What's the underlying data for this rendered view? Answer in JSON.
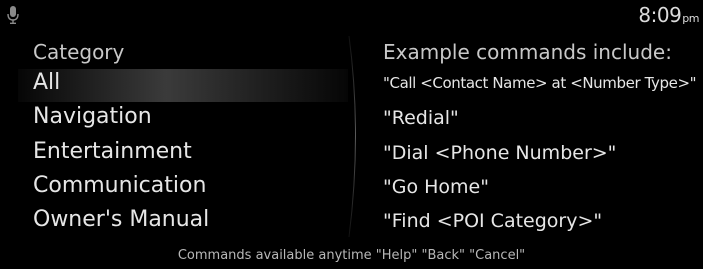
{
  "status_bar": {
    "mic_icon": "microphone-icon",
    "time": "8:09",
    "ampm": "pm"
  },
  "categories": {
    "heading": "Category",
    "selected_index": 0,
    "items": [
      {
        "label": "All"
      },
      {
        "label": "Navigation"
      },
      {
        "label": "Entertainment"
      },
      {
        "label": "Communication"
      },
      {
        "label": "Owner's Manual"
      }
    ]
  },
  "examples": {
    "heading": "Example commands include:",
    "commands": [
      {
        "text": "\"Call <Contact Name> at <Number Type>\""
      },
      {
        "text": "\"Redial\""
      },
      {
        "text": "\"Dial <Phone Number>\""
      },
      {
        "text": "\"Go Home\""
      },
      {
        "text": "\"Find <POI Category>\""
      }
    ]
  },
  "footer": {
    "text": "Commands available anytime \"Help\" \"Back\" \"Cancel\""
  },
  "colors": {
    "background": "#000000",
    "text": "#e6e6e6",
    "heading": "#c8c8c8"
  }
}
